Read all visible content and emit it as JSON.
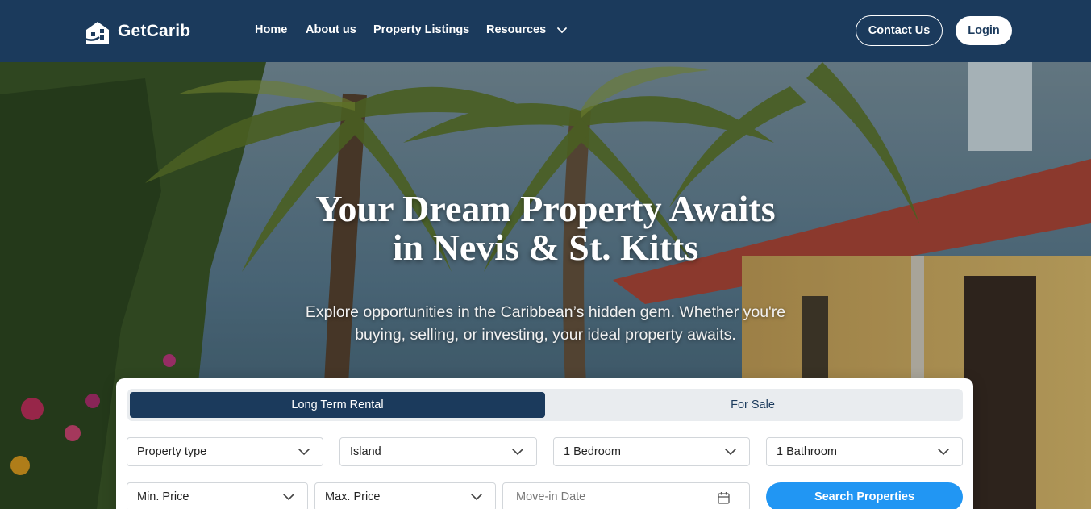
{
  "nav": {
    "logo_text": "GetCarib",
    "links": [
      "Home",
      "About us",
      "Property Listings",
      "Resources"
    ],
    "contact_label": "Contact Us",
    "login_label": "Login"
  },
  "hero": {
    "title_line1": "Your Dream Property Awaits",
    "title_line2": "in Nevis & St. Kitts",
    "subtitle_line1": "Explore opportunities in the Caribbean’s hidden gem. Whether you're",
    "subtitle_line2": "buying, selling, or investing, your ideal property awaits."
  },
  "search": {
    "tabs": [
      {
        "label": "Long Term Rental",
        "active": true
      },
      {
        "label": "For Sale",
        "active": false
      }
    ],
    "property_type": "Property type",
    "island": "Island",
    "bedrooms": "1 Bedroom",
    "bathrooms": "1 Bathroom",
    "min_price": "Min. Price",
    "max_price": "Max. Price",
    "move_in_placeholder": "Move-in Date",
    "submit_label": "Search Properties"
  },
  "colors": {
    "navy": "#1b3a5c",
    "accent_blue": "#2196f3"
  },
  "icons": [
    "logo-icon",
    "chevron-down-icon",
    "calendar-icon"
  ]
}
